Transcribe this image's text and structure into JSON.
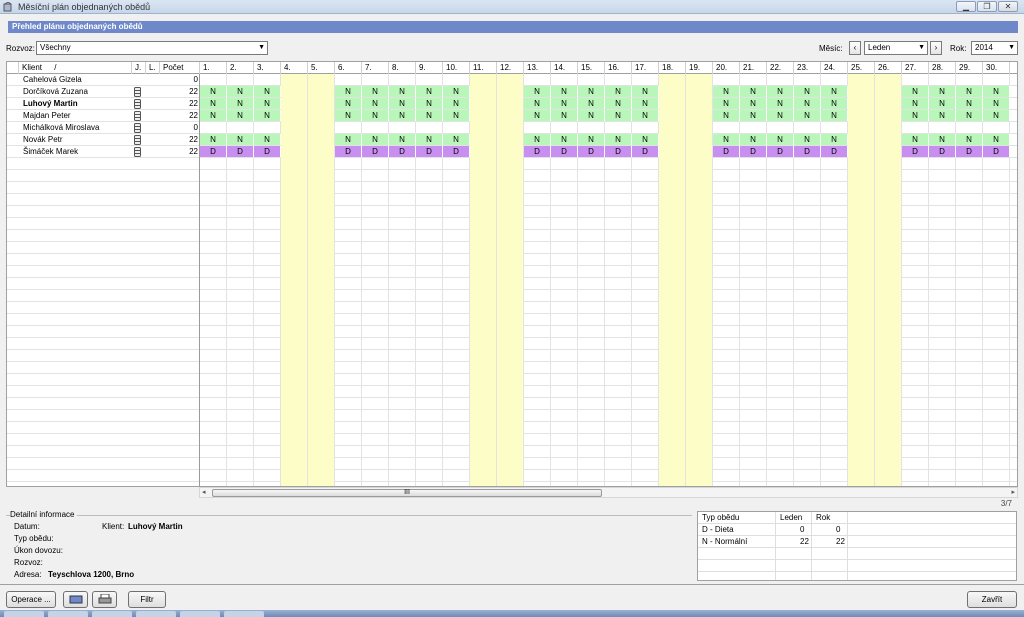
{
  "window": {
    "title": "Měsíční plán objednaných obědů"
  },
  "banner": "Přehled plánu objednaných obědů",
  "filters": {
    "rozvoz_label": "Rozvoz:",
    "rozvoz_value": "Všechny",
    "mesic_label": "Měsíc:",
    "mesic_value": "Leden",
    "rok_label": "Rok:",
    "rok_value": "2014"
  },
  "grid": {
    "headers": {
      "klient": "Klient",
      "sort_mark": "/",
      "j": "J.",
      "l": "L.",
      "pocet": "Počet"
    },
    "days": [
      "1.",
      "2.",
      "3.",
      "4.",
      "5.",
      "6.",
      "7.",
      "8.",
      "9.",
      "10.",
      "11.",
      "12.",
      "13.",
      "14.",
      "15.",
      "16.",
      "17.",
      "18.",
      "19.",
      "20.",
      "21.",
      "22.",
      "23.",
      "24.",
      "25.",
      "26.",
      "27.",
      "28.",
      "29.",
      "30."
    ],
    "weekend_days": [
      4,
      5,
      11,
      12,
      18,
      19,
      25,
      26
    ],
    "rows": [
      {
        "name": "Cahelová Gizela",
        "bold": false,
        "icon": false,
        "count": "0",
        "codes": ""
      },
      {
        "name": "Dorčíková Zuzana",
        "bold": false,
        "icon": true,
        "count": "22",
        "codes": "N"
      },
      {
        "name": "Luhový Martin",
        "bold": true,
        "icon": true,
        "count": "22",
        "codes": "N"
      },
      {
        "name": "Majdan Peter",
        "bold": false,
        "icon": true,
        "count": "22",
        "codes": "N"
      },
      {
        "name": "Michálková Miroslava",
        "bold": false,
        "icon": true,
        "count": "0",
        "codes": ""
      },
      {
        "name": "Novák Petr",
        "bold": false,
        "icon": true,
        "count": "22",
        "codes": "N"
      },
      {
        "name": "Šimáček Marek",
        "bold": false,
        "icon": true,
        "count": "22",
        "codes": "D"
      }
    ],
    "scroll_grip": "III",
    "pager": "3/7"
  },
  "detail": {
    "legend": "Detailní informace",
    "datum_label": "Datum:",
    "klient_label": "Klient:",
    "klient_value": "Luhový Martin",
    "typ_label": "Typ obědu:",
    "ukon_label": "Úkon dovozu:",
    "rozvoz_label": "Rozvoz:",
    "adresa_label": "Adresa:",
    "adresa_value": "Teyschlova 1200, Brno"
  },
  "summary": {
    "headers": [
      "Typ obědu",
      "Leden",
      "Rok"
    ],
    "rows": [
      [
        "D - Dieta",
        "0",
        "0"
      ],
      [
        "N - Normální",
        "22",
        "22"
      ]
    ]
  },
  "buttons": {
    "operace": "Operace ...",
    "filtr": "Filtr",
    "zavrit": "Zavřít"
  },
  "colors": {
    "normal": "#b9f6b9",
    "dieta": "#c88ef0",
    "weekend": "#fdfdc7",
    "banner": "#6f88c9"
  }
}
